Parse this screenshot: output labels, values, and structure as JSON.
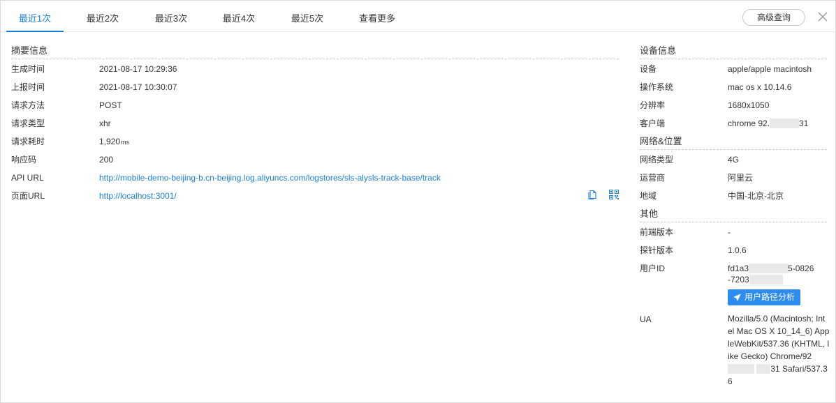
{
  "tabs": [
    "最近1次",
    "最近2次",
    "最近3次",
    "最近4次",
    "最近5次",
    "查看更多"
  ],
  "advanced_query_label": "高级查询",
  "summary": {
    "title": "摘要信息",
    "rows": [
      {
        "label": "生成时间",
        "value": "2021-08-17 10:29:36"
      },
      {
        "label": "上报时间",
        "value": "2021-08-17 10:30:07"
      },
      {
        "label": "请求方法",
        "value": "POST"
      },
      {
        "label": "请求类型",
        "value": "xhr"
      },
      {
        "label": "请求耗时",
        "value": "1,920",
        "unit": "ms"
      },
      {
        "label": "响应码",
        "value": "200"
      },
      {
        "label": "API URL",
        "value": "http://mobile-demo-beijing-b.cn-beijing.log.aliyuncs.com/logstores/sls-alysls-track-base/track"
      },
      {
        "label": "页面URL",
        "value": "http://localhost:3001/"
      }
    ]
  },
  "device": {
    "title": "设备信息",
    "rows": [
      {
        "label": "设备",
        "value": "apple/apple macintosh"
      },
      {
        "label": "操作系统",
        "value": "mac os x 10.14.6"
      },
      {
        "label": "分辨率",
        "value": "1680x1050"
      },
      {
        "label": "客户端",
        "value_start": "chrome 92.",
        "value_end": "31"
      }
    ]
  },
  "network": {
    "title": "网络&位置",
    "rows": [
      {
        "label": "网络类型",
        "value": "4G"
      },
      {
        "label": "运营商",
        "value": "阿里云"
      },
      {
        "label": "地域",
        "value": "中国-北京-北京"
      }
    ]
  },
  "other": {
    "title": "其他",
    "rows": [
      {
        "label": "前端版本",
        "value": "-"
      },
      {
        "label": "探针版本",
        "value": "1.0.6"
      },
      {
        "label": "用户ID",
        "line1_start": "fd1a3",
        "line1_end": "5-0826",
        "line2_start": "-7203"
      },
      {
        "label": "UA"
      }
    ],
    "path_button_label": "用户路径分析",
    "ua_part1": "Mozilla/5.0 (Macintosh; Intel Mac OS X 10_14_6) AppleWebKit/537.36 (KHTML, like Gecko) Chrome/92",
    "ua_part2": "31 Safari/537.36"
  },
  "colors": {
    "accent": "#1a7fd8",
    "button_blue": "#2d8cf0",
    "text": "#333333",
    "border": "#d9d9d9"
  },
  "icons": [
    "close-icon",
    "copy-icon",
    "qrcode-icon",
    "send-icon"
  ]
}
